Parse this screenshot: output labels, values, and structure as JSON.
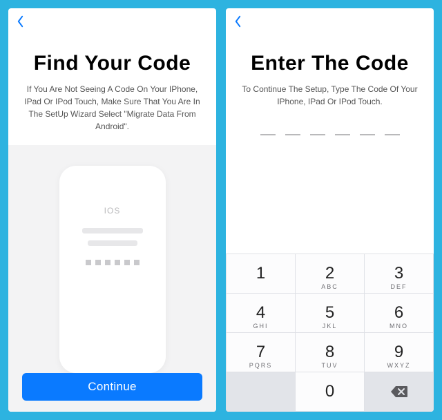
{
  "colors": {
    "bg": "#2db3e0",
    "primary": "#0a7aff"
  },
  "left": {
    "title": "Find Your Code",
    "body": "If You Are Not Seeing A Code On Your IPhone, IPad Or IPod Touch, Make Sure That You Are In The SetUp Wizard Select \"Migrate Data From Android\".",
    "phone_label": "IOS",
    "continue_label": "Continue"
  },
  "right": {
    "title": "Enter The Code",
    "body": "To Continue The Setup, Type The Code Of Your IPhone, IPad Or IPod Touch.",
    "digit_count": 6,
    "keypad": {
      "keys": [
        "1",
        "2",
        "3",
        "4",
        "5",
        "6",
        "7",
        "8",
        "9",
        "0"
      ],
      "subs": {
        "2": "ABC",
        "3": "DEF",
        "4": "GHI",
        "5": "JKL",
        "6": "MNO",
        "7": "PQRS",
        "8": "TUV",
        "9": "WXYZ"
      }
    }
  }
}
